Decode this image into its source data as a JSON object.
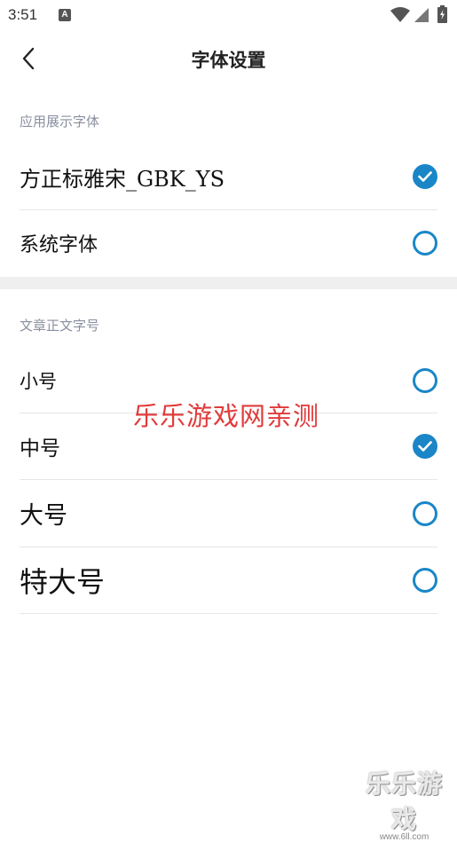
{
  "status_bar": {
    "time": "3:51",
    "notification_icon": "a-icon",
    "wifi_icon": "wifi-icon",
    "signal_icon": "signal-icon",
    "battery_icon": "battery-icon"
  },
  "header": {
    "back_icon": "chevron-left-icon",
    "title": "字体设置"
  },
  "app_font_section": {
    "label": "应用展示字体",
    "options": [
      {
        "label": "方正标雅宋_GBK_YS",
        "selected": true
      },
      {
        "label": "系统字体",
        "selected": false
      }
    ]
  },
  "body_size_section": {
    "label": "文章正文字号",
    "options": [
      {
        "label": "小号",
        "selected": false
      },
      {
        "label": "中号",
        "selected": true
      },
      {
        "label": "大号",
        "selected": false
      },
      {
        "label": "特大号",
        "selected": false
      }
    ]
  },
  "watermark": {
    "center_text": "乐乐游戏网亲测",
    "corner_text": "乐乐游戏",
    "corner_url": "www.6ll.com"
  },
  "colors": {
    "accent": "#1a86c7",
    "section_label": "#8a8fa0",
    "watermark_red": "#e03b3b"
  }
}
